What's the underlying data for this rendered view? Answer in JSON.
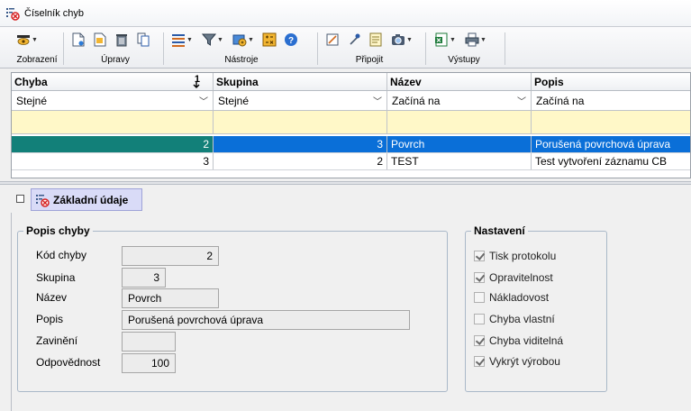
{
  "window": {
    "title": "Číselník chyb"
  },
  "ribbon": {
    "groups": [
      {
        "label": "Zobrazení"
      },
      {
        "label": "Úpravy"
      },
      {
        "label": "Nástroje"
      },
      {
        "label": "Připojit"
      },
      {
        "label": "Výstupy"
      }
    ]
  },
  "grid": {
    "columns": [
      {
        "header": "Chyba",
        "filter": "Stejné",
        "sort_indicator": "1"
      },
      {
        "header": "Skupina",
        "filter": "Stejné"
      },
      {
        "header": "Název",
        "filter": "Začíná na"
      },
      {
        "header": "Popis",
        "filter": "Začíná na"
      }
    ],
    "rows": [
      {
        "chyba": "2",
        "skupina": "3",
        "nazev": "Povrch",
        "popis": "Porušená povrchová úprava",
        "selected": true
      },
      {
        "chyba": "3",
        "skupina": "2",
        "nazev": "TEST",
        "popis": "Test vytvoření záznamu CB",
        "selected": false
      }
    ]
  },
  "detail": {
    "tab_label": "Základní údaje",
    "popis_group": {
      "title": "Popis chyby",
      "fields": {
        "kod_label": "Kód chyby",
        "kod_value": "2",
        "skupina_label": "Skupina",
        "skupina_value": "3",
        "nazev_label": "Název",
        "nazev_value": "Povrch",
        "popis_label": "Popis",
        "popis_value": "Porušená povrchová úprava",
        "zavineni_label": "Zavinění",
        "zavineni_value": "",
        "odpovednost_label": "Odpovědnost",
        "odpovednost_value": "100"
      }
    },
    "nastaveni_group": {
      "title": "Nastavení",
      "options": [
        {
          "label": "Tisk protokolu",
          "checked": true
        },
        {
          "label": "Opravitelnost",
          "checked": true
        },
        {
          "label": "Nákladovost",
          "checked": false
        },
        {
          "label": "Chyba vlastní",
          "checked": false
        },
        {
          "label": "Chyba viditelná",
          "checked": true
        },
        {
          "label": "Vykrýt výrobou",
          "checked": true
        }
      ]
    }
  },
  "colors": {
    "selected_row": "#0a6fd8",
    "selected_key_cell": "#128079",
    "filter_row": "#fff8c8",
    "tab_bg": "#d9dbf7"
  }
}
